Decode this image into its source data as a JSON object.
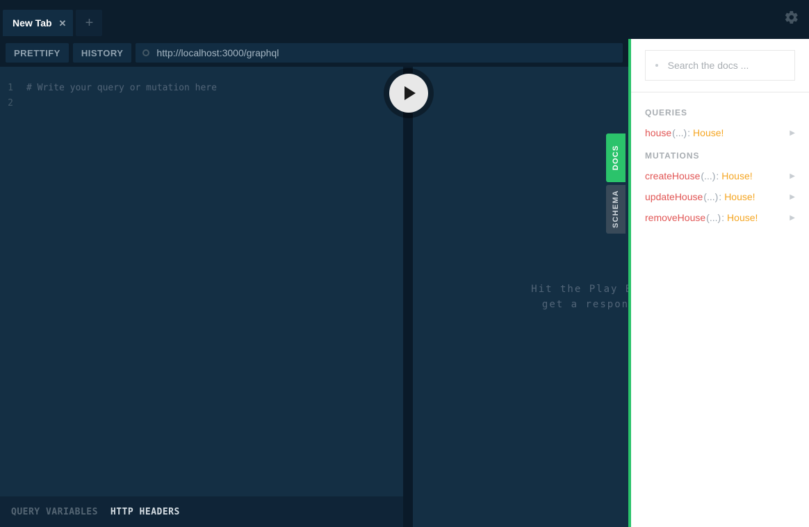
{
  "tab": {
    "title": "New Tab"
  },
  "toolbar": {
    "prettify": "PRETTIFY",
    "history": "HISTORY",
    "endpoint": "http://localhost:3000/graphql"
  },
  "editor": {
    "lines": [
      "1",
      "2"
    ],
    "placeholder": "# Write your query or mutation here"
  },
  "result": {
    "hint_line1": "Hit the Play Button to",
    "hint_line2": "get a response here"
  },
  "bottom": {
    "query_variables": "QUERY VARIABLES",
    "http_headers": "HTTP HEADERS"
  },
  "sidetabs": {
    "docs": "DOCS",
    "schema": "SCHEMA"
  },
  "docs": {
    "search_placeholder": "Search the docs ...",
    "sections": [
      {
        "title": "QUERIES",
        "items": [
          {
            "name": "house",
            "args": "(...)",
            "type": "House!"
          }
        ]
      },
      {
        "title": "MUTATIONS",
        "items": [
          {
            "name": "createHouse",
            "args": "(...)",
            "type": "House!"
          },
          {
            "name": "updateHouse",
            "args": "(...)",
            "type": "House!"
          },
          {
            "name": "removeHouse",
            "args": "(...)",
            "type": "House!"
          }
        ]
      }
    ]
  }
}
